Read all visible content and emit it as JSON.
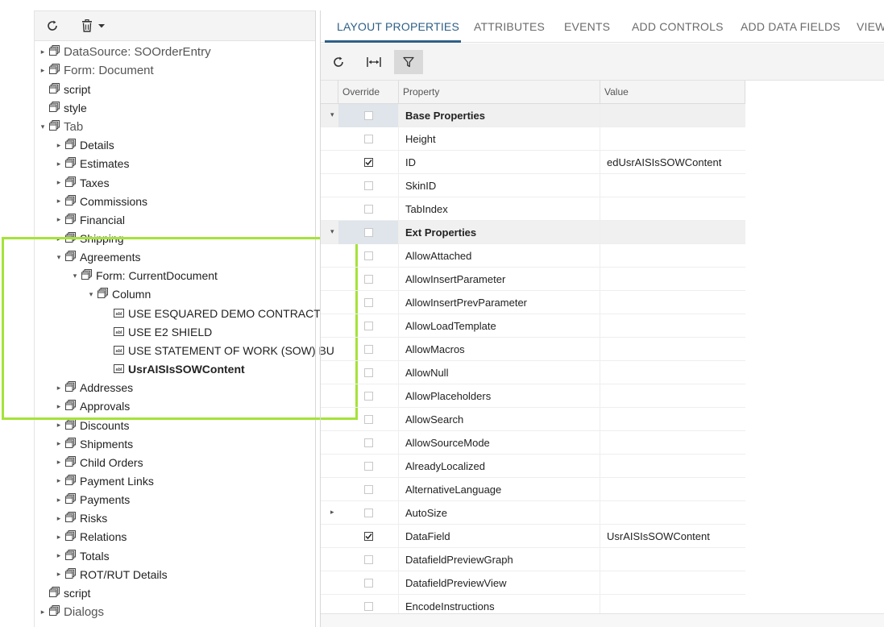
{
  "left_toolbar": {
    "refresh_icon": "refresh-icon",
    "delete_icon": "trash-icon",
    "dropdown_icon": "caret-down-icon"
  },
  "tree": [
    {
      "label": "DataSource: SOOrderEntry",
      "expander": "collapsed",
      "icon": "node-icon",
      "level": 0,
      "bold": false,
      "big": true
    },
    {
      "label": "Form: Document",
      "expander": "collapsed",
      "icon": "node-icon",
      "level": 0,
      "bold": false,
      "big": true
    },
    {
      "label": "script",
      "expander": "none",
      "icon": "node-icon",
      "level": 0,
      "bold": false,
      "big": false
    },
    {
      "label": "style",
      "expander": "none",
      "icon": "node-icon",
      "level": 0,
      "bold": false,
      "big": false
    },
    {
      "label": "Tab",
      "expander": "expanded",
      "icon": "node-icon",
      "level": 0,
      "bold": false,
      "big": true
    },
    {
      "label": "Details",
      "expander": "collapsed",
      "icon": "node-icon",
      "level": 1,
      "bold": false,
      "big": false
    },
    {
      "label": "Estimates",
      "expander": "collapsed",
      "icon": "node-icon",
      "level": 1,
      "bold": false,
      "big": false
    },
    {
      "label": "Taxes",
      "expander": "collapsed",
      "icon": "node-icon",
      "level": 1,
      "bold": false,
      "big": false
    },
    {
      "label": "Commissions",
      "expander": "collapsed",
      "icon": "node-icon",
      "level": 1,
      "bold": false,
      "big": false
    },
    {
      "label": "Financial",
      "expander": "collapsed",
      "icon": "node-icon",
      "level": 1,
      "bold": false,
      "big": false
    },
    {
      "label": "Shipping",
      "expander": "collapsed",
      "icon": "node-icon",
      "level": 1,
      "bold": false,
      "big": false
    },
    {
      "label": "Agreements",
      "expander": "expanded",
      "icon": "node-icon",
      "level": 1,
      "bold": false,
      "big": false
    },
    {
      "label": "Form: CurrentDocument",
      "expander": "expanded",
      "icon": "node-icon",
      "level": 2,
      "bold": false,
      "big": false
    },
    {
      "label": "Column",
      "expander": "expanded",
      "icon": "node-icon",
      "level": 3,
      "bold": false,
      "big": false
    },
    {
      "label": "USE ESQUARED DEMO CONTRACT",
      "expander": "none",
      "icon": "field-icon",
      "level": 4,
      "bold": false,
      "big": false
    },
    {
      "label": "USE E2 SHIELD",
      "expander": "none",
      "icon": "field-icon",
      "level": 4,
      "bold": false,
      "big": false
    },
    {
      "label": "USE STATEMENT OF WORK (SOW) BU",
      "expander": "none",
      "icon": "field-icon",
      "level": 4,
      "bold": false,
      "big": false
    },
    {
      "label": "UsrAISIsSOWContent",
      "expander": "none",
      "icon": "field-icon",
      "level": 4,
      "bold": true,
      "big": false
    },
    {
      "label": "Addresses",
      "expander": "collapsed",
      "icon": "node-icon",
      "level": 1,
      "bold": false,
      "big": false
    },
    {
      "label": "Approvals",
      "expander": "collapsed",
      "icon": "node-icon",
      "level": 1,
      "bold": false,
      "big": false
    },
    {
      "label": "Discounts",
      "expander": "collapsed",
      "icon": "node-icon",
      "level": 1,
      "bold": false,
      "big": false
    },
    {
      "label": "Shipments",
      "expander": "collapsed",
      "icon": "node-icon",
      "level": 1,
      "bold": false,
      "big": false
    },
    {
      "label": "Child Orders",
      "expander": "collapsed",
      "icon": "node-icon",
      "level": 1,
      "bold": false,
      "big": false
    },
    {
      "label": "Payment Links",
      "expander": "collapsed",
      "icon": "node-icon",
      "level": 1,
      "bold": false,
      "big": false
    },
    {
      "label": "Payments",
      "expander": "collapsed",
      "icon": "node-icon",
      "level": 1,
      "bold": false,
      "big": false
    },
    {
      "label": "Risks",
      "expander": "collapsed",
      "icon": "node-icon",
      "level": 1,
      "bold": false,
      "big": false
    },
    {
      "label": "Relations",
      "expander": "collapsed",
      "icon": "node-icon",
      "level": 1,
      "bold": false,
      "big": false
    },
    {
      "label": "Totals",
      "expander": "collapsed",
      "icon": "node-icon",
      "level": 1,
      "bold": false,
      "big": false
    },
    {
      "label": "ROT/RUT Details",
      "expander": "collapsed",
      "icon": "node-icon",
      "level": 1,
      "bold": false,
      "big": false
    },
    {
      "label": "script",
      "expander": "none",
      "icon": "node-icon",
      "level": 0,
      "bold": false,
      "big": false
    },
    {
      "label": "Dialogs",
      "expander": "collapsed",
      "icon": "node-icon",
      "level": 0,
      "bold": false,
      "big": true
    }
  ],
  "highlight": {
    "color": "#a5e23a"
  },
  "tabs": [
    {
      "label": "LAYOUT PROPERTIES",
      "active": true
    },
    {
      "label": "ATTRIBUTES",
      "active": false
    },
    {
      "label": "EVENTS",
      "active": false
    },
    {
      "label": "ADD CONTROLS",
      "active": false
    },
    {
      "label": "ADD DATA FIELDS",
      "active": false
    },
    {
      "label": "VIEW",
      "active": false
    }
  ],
  "grid_toolbar": {
    "refresh_icon": "refresh-icon",
    "fit_icon": "fit-columns-icon",
    "filter_icon": "filter-icon",
    "filter_active": true
  },
  "grid": {
    "columns": [
      "Override",
      "Property",
      "Value"
    ],
    "rows": [
      {
        "property": "Base Properties",
        "value": "",
        "checked": false,
        "group": true,
        "expander": "expanded"
      },
      {
        "property": "Height",
        "value": "",
        "checked": false,
        "group": false,
        "expander": ""
      },
      {
        "property": "ID",
        "value": "edUsrAISIsSOWContent",
        "checked": true,
        "group": false,
        "expander": ""
      },
      {
        "property": "SkinID",
        "value": "",
        "checked": false,
        "group": false,
        "expander": ""
      },
      {
        "property": "TabIndex",
        "value": "",
        "checked": false,
        "group": false,
        "expander": ""
      },
      {
        "property": "Ext Properties",
        "value": "",
        "checked": false,
        "group": true,
        "expander": "expanded"
      },
      {
        "property": "AllowAttached",
        "value": "",
        "checked": false,
        "group": false,
        "expander": ""
      },
      {
        "property": "AllowInsertParameter",
        "value": "",
        "checked": false,
        "group": false,
        "expander": ""
      },
      {
        "property": "AllowInsertPrevParameter",
        "value": "",
        "checked": false,
        "group": false,
        "expander": ""
      },
      {
        "property": "AllowLoadTemplate",
        "value": "",
        "checked": false,
        "group": false,
        "expander": ""
      },
      {
        "property": "AllowMacros",
        "value": "",
        "checked": false,
        "group": false,
        "expander": ""
      },
      {
        "property": "AllowNull",
        "value": "",
        "checked": false,
        "group": false,
        "expander": ""
      },
      {
        "property": "AllowPlaceholders",
        "value": "",
        "checked": false,
        "group": false,
        "expander": ""
      },
      {
        "property": "AllowSearch",
        "value": "",
        "checked": false,
        "group": false,
        "expander": ""
      },
      {
        "property": "AllowSourceMode",
        "value": "",
        "checked": false,
        "group": false,
        "expander": ""
      },
      {
        "property": "AlreadyLocalized",
        "value": "",
        "checked": false,
        "group": false,
        "expander": ""
      },
      {
        "property": "AlternativeLanguage",
        "value": "",
        "checked": false,
        "group": false,
        "expander": ""
      },
      {
        "property": "AutoSize",
        "value": "",
        "checked": false,
        "group": false,
        "expander": "collapsed"
      },
      {
        "property": "DataField",
        "value": "UsrAISIsSOWContent",
        "checked": true,
        "group": false,
        "expander": ""
      },
      {
        "property": "DatafieldPreviewGraph",
        "value": "",
        "checked": false,
        "group": false,
        "expander": ""
      },
      {
        "property": "DatafieldPreviewView",
        "value": "",
        "checked": false,
        "group": false,
        "expander": ""
      },
      {
        "property": "EncodeInstructions",
        "value": "",
        "checked": false,
        "group": false,
        "expander": ""
      }
    ]
  }
}
